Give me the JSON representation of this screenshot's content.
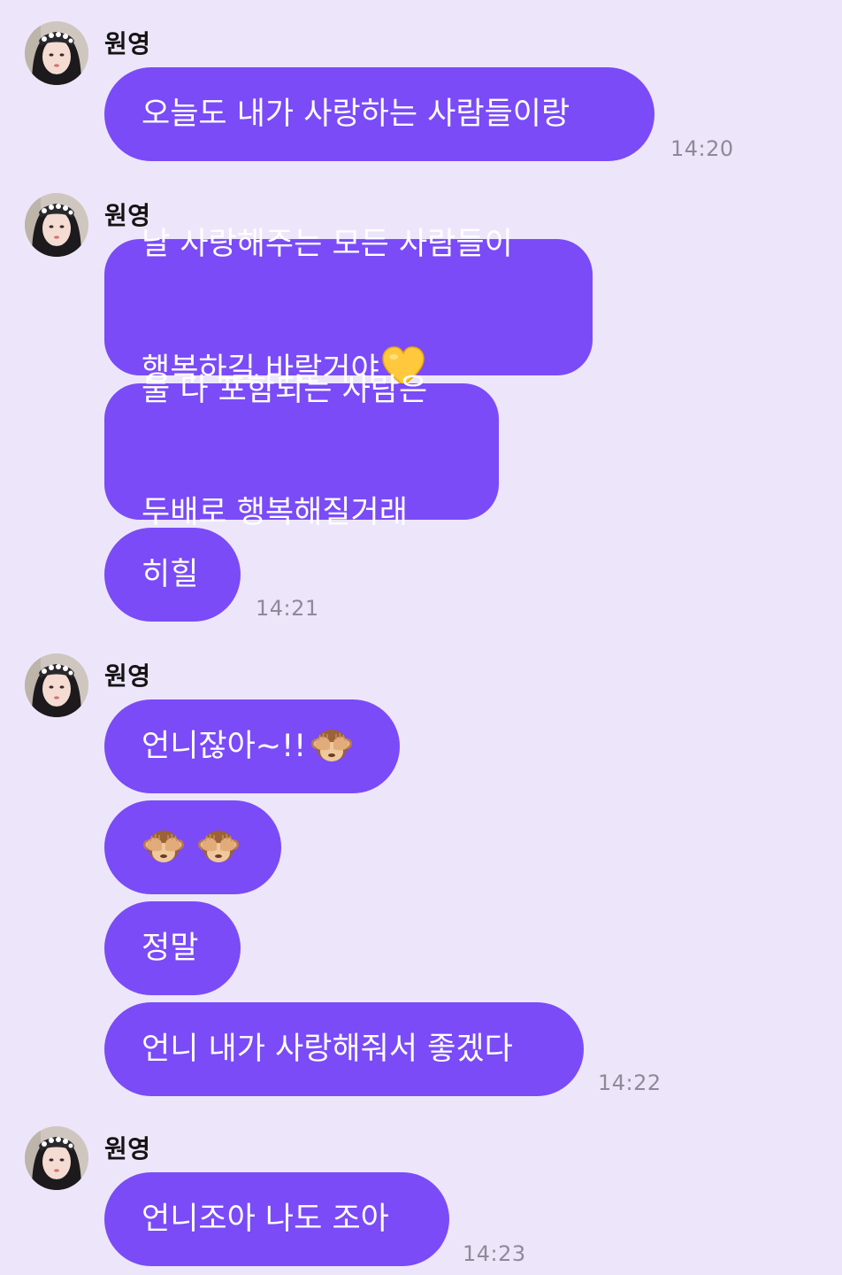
{
  "sender_name": "원영",
  "colors": {
    "background": "#EDE6FB",
    "bubble": "#7A4BF7",
    "bubble_text": "#FFFFFF",
    "timestamp": "#8E8A98"
  },
  "messages": [
    {
      "text": "오늘도 내가 사랑하는 사람들이랑",
      "time": "14:20"
    },
    {
      "line1": "날 사랑해주는 모든 사람들이",
      "line2": "행복하길 바랄거야",
      "emoji": "yellow-heart"
    },
    {
      "line1": "둘 다 포함되는 사람은",
      "line2": "두배로 행복해질거래"
    },
    {
      "text": "히힐",
      "time": "14:21"
    },
    {
      "text": "언니잖아~!!",
      "emoji": "see-no-evil-monkey"
    },
    {
      "emoji": "see-no-evil-monkey x2"
    },
    {
      "text": "정말"
    },
    {
      "text": "언니 내가 사랑해줘서 좋겠다",
      "time": "14:22"
    },
    {
      "text": "언니조아 나도 조아",
      "time": "14:23"
    }
  ]
}
